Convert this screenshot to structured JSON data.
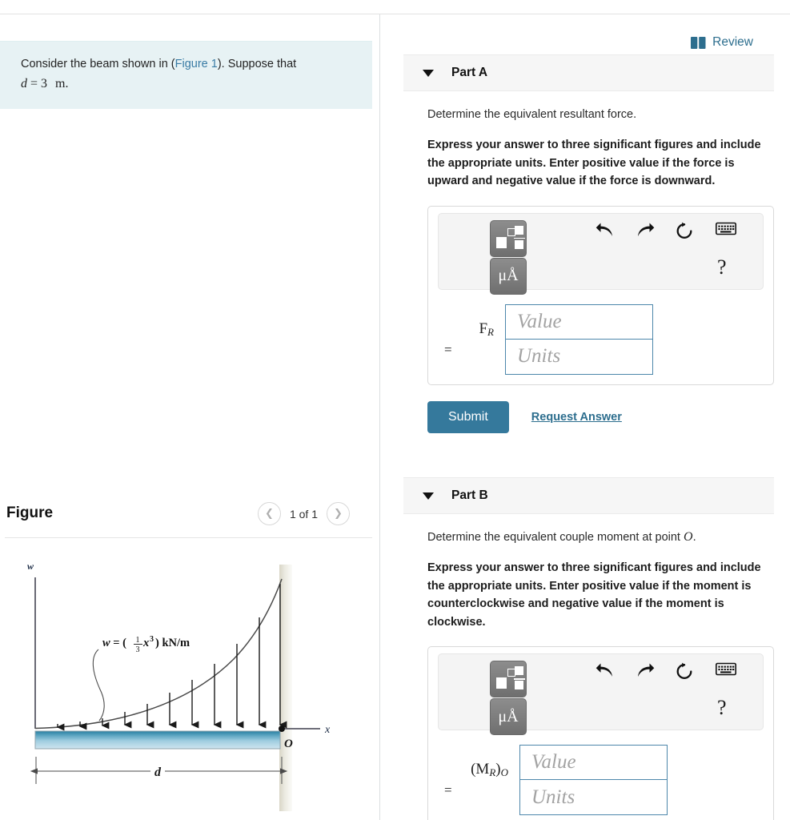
{
  "left_panel": {
    "question": {
      "text_before_link": "Consider the beam shown in (",
      "link_label": "Figure 1",
      "text_after_link": "). Suppose that",
      "given_variable": "d",
      "given_equals": "= 3",
      "given_units": "m",
      "given_period": "."
    },
    "figure_section": {
      "title": "Figure",
      "prev_icon": "chevron-left-icon",
      "next_icon": "chevron-right-icon",
      "counter": "1 of 1"
    },
    "figure_diagram": {
      "vertical_axis_label": "w",
      "horizontal_axis_label": "x",
      "origin_label": "O",
      "dimension_label": "d",
      "load_equation": "w = (⅓x³) kN/m",
      "load_equation_parts": {
        "lhs": "w",
        "equals": "=",
        "open_paren": "(",
        "numerator": "1",
        "denominator": "3",
        "variable": "x",
        "exponent": "3",
        "close_paren": ")",
        "units": "kN/m"
      },
      "beam_color_top": "#1d6e8e",
      "beam_color_bottom": "#bcd9e8",
      "wall_color": "#e9e7dc",
      "arrow_count": 11
    }
  },
  "right_panel": {
    "review": {
      "label": "Review",
      "icon": "book-icon",
      "color": "#2d6e8e"
    },
    "parts": [
      {
        "id": "part-a",
        "title": "Part A",
        "caret_icon": "caret-down-icon",
        "prompt": "Determine the equivalent resultant force.",
        "prompt_math": "",
        "instructions": "Express your answer to three significant figures and include the appropriate units. Enter positive value if the force is upward and negative value if the force is downward.",
        "toolbar": {
          "symbol_button": "math-template-icon",
          "units_button": "μÅ",
          "undo_icon": "undo-arrow-icon",
          "redo_icon": "redo-arrow-icon",
          "reset_icon": "reset-circular-arrow-icon",
          "keyboard_icon": "keyboard-icon",
          "help_label": "?"
        },
        "entry": {
          "label_main": "F",
          "label_sub": "R",
          "label_suffix": "",
          "equals": "=",
          "value_placeholder": "Value",
          "units_placeholder": "Units",
          "value": "",
          "units": ""
        },
        "submit_label": "Submit",
        "request_answer_label": "Request Answer",
        "has_actions": true
      },
      {
        "id": "part-b",
        "title": "Part B",
        "caret_icon": "caret-down-icon",
        "prompt": "Determine the equivalent couple moment at point",
        "prompt_math": "O",
        "instructions": "Express your answer to three significant figures and include the appropriate units. Enter positive value if the moment is counterclockwise and negative value if the moment is clockwise.",
        "toolbar": {
          "symbol_button": "math-template-icon",
          "units_button": "μÅ",
          "undo_icon": "undo-arrow-icon",
          "redo_icon": "redo-arrow-icon",
          "reset_icon": "reset-circular-arrow-icon",
          "keyboard_icon": "keyboard-icon",
          "help_label": "?"
        },
        "entry": {
          "label_main": "(M",
          "label_sub": "R",
          "label_suffix": ")",
          "label_sub2": "O",
          "equals": "=",
          "value_placeholder": "Value",
          "units_placeholder": "Units",
          "value": "",
          "units": ""
        },
        "has_actions": false
      }
    ]
  },
  "colors": {
    "accent": "#2d6e8e",
    "submit_bg": "#35799c",
    "question_bg": "#e7f2f4",
    "part_header_bg": "#f6f6f6",
    "field_border": "#4d87ab"
  }
}
